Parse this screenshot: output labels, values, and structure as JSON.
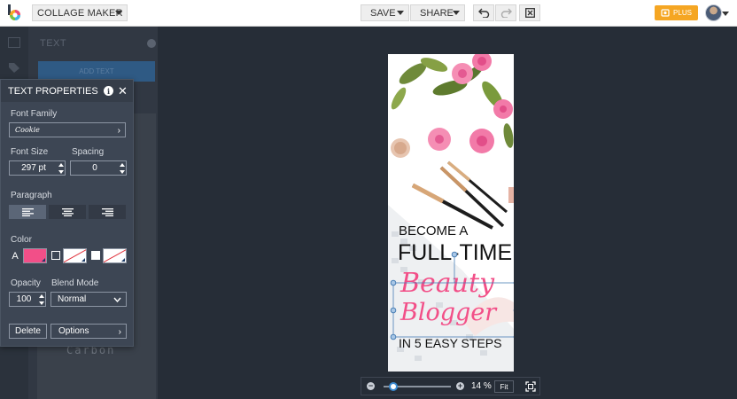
{
  "topbar": {
    "app_name": "COLLAGE MAKER",
    "save_label": "SAVE",
    "share_label": "SHARE",
    "plus_label": "PLUS",
    "icons": [
      "logo-icon",
      "undo-icon",
      "redo-icon",
      "close-icon",
      "crown-icon",
      "avatar"
    ]
  },
  "left_panel": {
    "section_title": "TEXT",
    "add_text_label": "ADD TEXT",
    "sample_font_text": "Carbon"
  },
  "text_properties": {
    "title": "TEXT PROPERTIES",
    "font_family_label": "Font Family",
    "font_family_value": "Cookie",
    "font_size_label": "Font Size",
    "font_size_value": "297 pt",
    "spacing_label": "Spacing",
    "spacing_value": "0",
    "paragraph_label": "Paragraph",
    "paragraph_align": "left",
    "color_label": "Color",
    "color_text_letter": "A",
    "text_color": "#f24f88",
    "opacity_label": "Opacity",
    "opacity_value": "100",
    "blend_mode_label": "Blend Mode",
    "blend_mode_value": "Normal",
    "delete_label": "Delete",
    "options_label": "Options"
  },
  "canvas": {
    "line1": "BECOME A",
    "line2": "FULL-TIME",
    "line3": "Beauty",
    "line4": "Blogger",
    "line5": "IN 5 EASY STEPS",
    "accent_color": "#f24f88"
  },
  "zoom": {
    "percent": "14 %",
    "fit_label": "Fit",
    "level": 0.14
  }
}
